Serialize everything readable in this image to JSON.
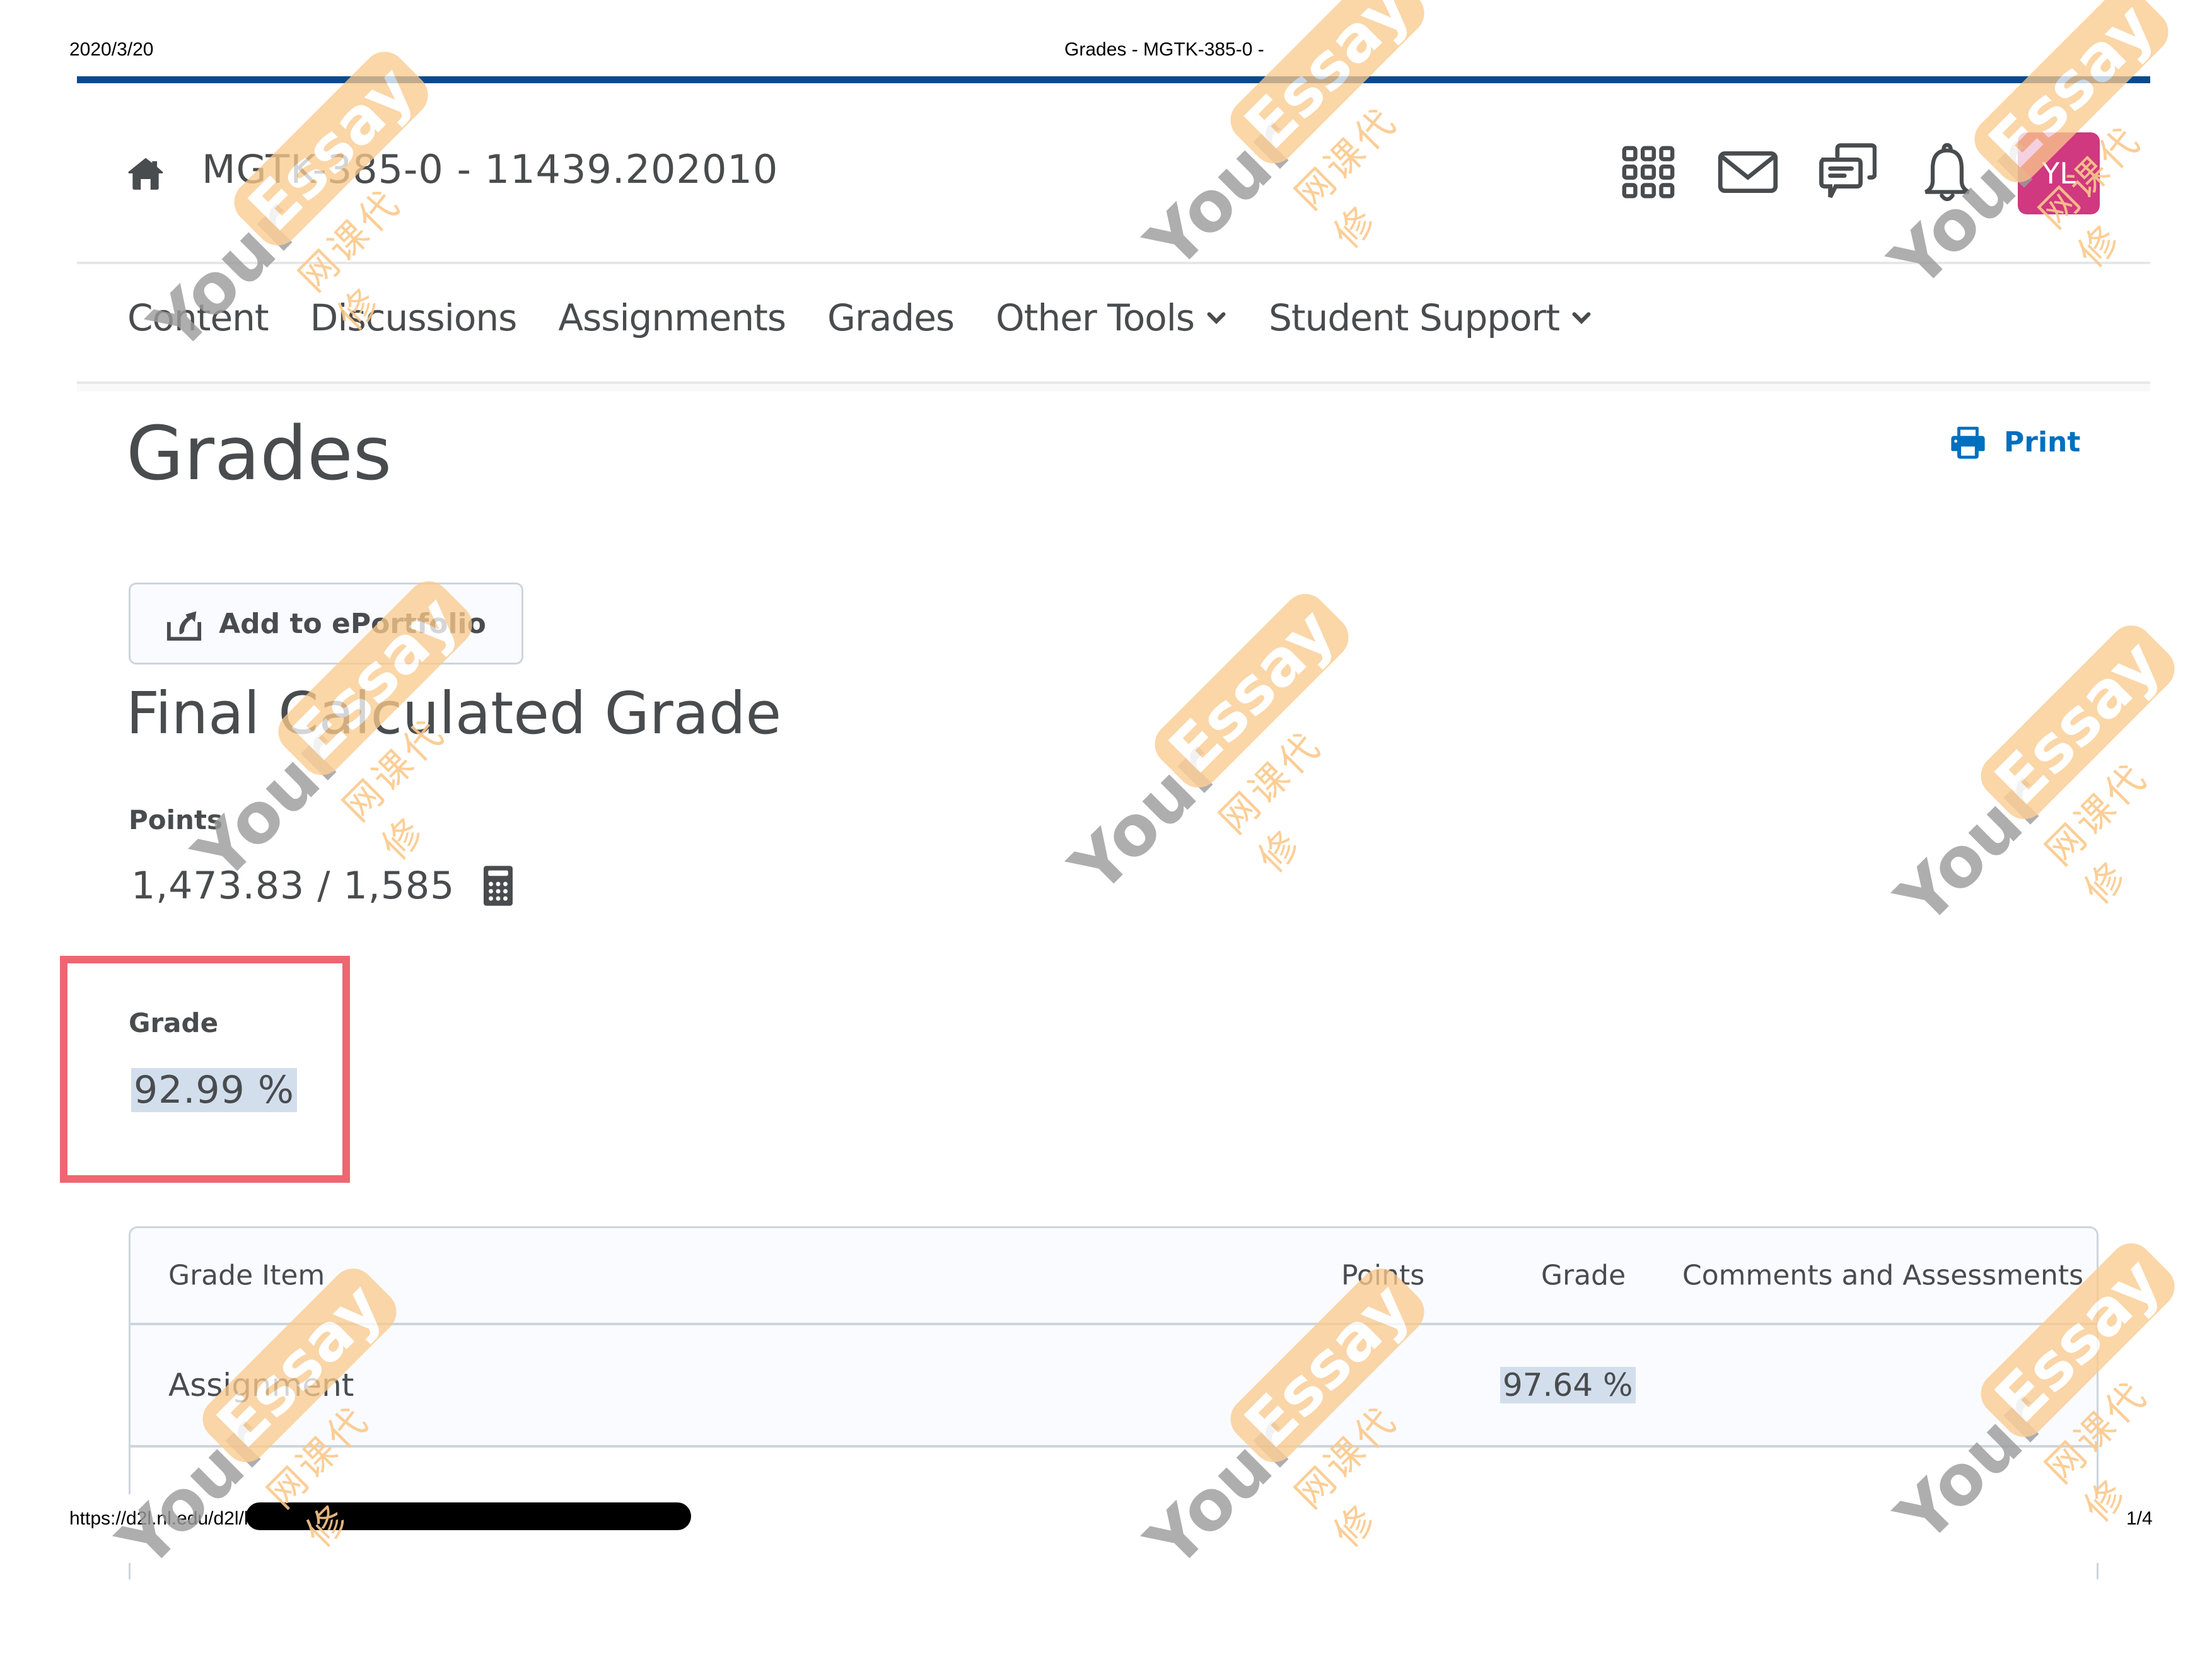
{
  "print_header": {
    "date": "2020/3/20",
    "document_title": "Grades - MGTK-385-0 - "
  },
  "print_footer": {
    "url": "https://d2l.nl.edu/d2l/lms/grades",
    "page_indicator": "1/4"
  },
  "header": {
    "home_icon": "home-icon",
    "course_title": "MGTK-385-0 - 11439.202010",
    "icons": [
      "waffle-grid-icon",
      "mail-icon",
      "chat-bubbles-icon",
      "bell-icon"
    ],
    "avatar_initials": "YL",
    "avatar_color": "#d0387f",
    "accent_bar_color": "#0a4a8c"
  },
  "nav": {
    "items": [
      {
        "label": "Content",
        "has_dropdown": false
      },
      {
        "label": "Discussions",
        "has_dropdown": false
      },
      {
        "label": "Assignments",
        "has_dropdown": false
      },
      {
        "label": "Grades",
        "has_dropdown": false
      },
      {
        "label": "Other Tools",
        "has_dropdown": true
      },
      {
        "label": "Student Support",
        "has_dropdown": true
      }
    ]
  },
  "page": {
    "title": "Grades",
    "print_label": "Print",
    "print_color": "#006fbf",
    "add_portfolio_label": "Add to ePortfolio"
  },
  "final_grade": {
    "section_title": "Final Calculated Grade",
    "points_label": "Points",
    "points_value": "1,473.83 / 1,585",
    "grade_label": "Grade",
    "grade_value": "92.99 %",
    "highlight_box_color": "#ef6672"
  },
  "grades_table": {
    "columns": [
      "Grade Item",
      "Points",
      "Grade",
      "Comments and Assessments"
    ],
    "rows": [
      {
        "item": "Assignment",
        "points": "",
        "grade": "97.64 %",
        "comments": ""
      }
    ]
  },
  "watermark": {
    "word1": "Your",
    "word2": "Essay",
    "chinese": "网课代修"
  }
}
